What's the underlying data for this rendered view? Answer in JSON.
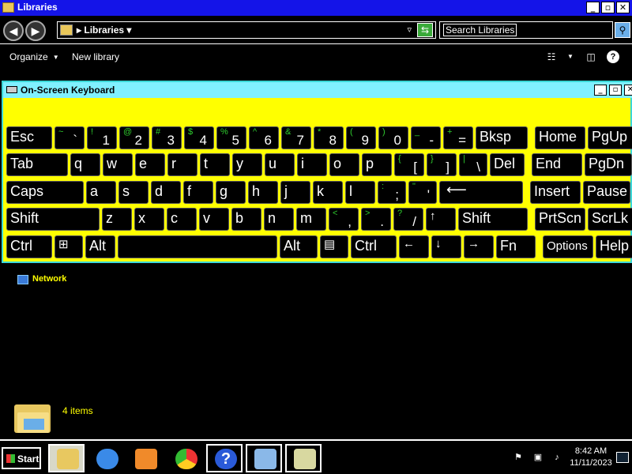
{
  "window": {
    "title": "Libraries",
    "minimize": "_",
    "maximize": "▫",
    "close": "✕"
  },
  "address": {
    "path_sep": "▸",
    "path": "Libraries",
    "path_drop": "▾",
    "dropdown": "▿",
    "search_placeholder": "Search Libraries"
  },
  "commands": {
    "organize": "Organize",
    "new_library": "New library"
  },
  "osk": {
    "title": "On-Screen Keyboard",
    "rows": [
      [
        {
          "id": "esc",
          "label": "Esc"
        },
        {
          "id": "backtick",
          "sec": "~",
          "pri": "`"
        },
        {
          "id": "1",
          "sec": "!",
          "pri": "1"
        },
        {
          "id": "2",
          "sec": "@",
          "pri": "2"
        },
        {
          "id": "3",
          "sec": "#",
          "pri": "3"
        },
        {
          "id": "4",
          "sec": "$",
          "pri": "4"
        },
        {
          "id": "5",
          "sec": "%",
          "pri": "5"
        },
        {
          "id": "6",
          "sec": "^",
          "pri": "6"
        },
        {
          "id": "7",
          "sec": "&",
          "pri": "7"
        },
        {
          "id": "8",
          "sec": "*",
          "pri": "8"
        },
        {
          "id": "9",
          "sec": "(",
          "pri": "9"
        },
        {
          "id": "0",
          "sec": ")",
          "pri": "0"
        },
        {
          "id": "minus",
          "sec": "_",
          "pri": "-"
        },
        {
          "id": "equals",
          "sec": "+",
          "pri": "="
        },
        {
          "id": "bksp",
          "label": "Bksp"
        },
        {
          "id": "home",
          "label": "Home"
        },
        {
          "id": "pgup",
          "label": "PgUp"
        }
      ],
      [
        {
          "id": "tab",
          "label": "Tab"
        },
        {
          "id": "q",
          "label": "q"
        },
        {
          "id": "w",
          "label": "w"
        },
        {
          "id": "e",
          "label": "e"
        },
        {
          "id": "r",
          "label": "r"
        },
        {
          "id": "t",
          "label": "t"
        },
        {
          "id": "y",
          "label": "y"
        },
        {
          "id": "u",
          "label": "u"
        },
        {
          "id": "i",
          "label": "i"
        },
        {
          "id": "o",
          "label": "o"
        },
        {
          "id": "p",
          "label": "p"
        },
        {
          "id": "lbracket",
          "sec": "{",
          "pri": "["
        },
        {
          "id": "rbracket",
          "sec": "}",
          "pri": "]"
        },
        {
          "id": "backslash",
          "sec": "|",
          "pri": "\\"
        },
        {
          "id": "del",
          "label": "Del"
        },
        {
          "id": "end",
          "label": "End"
        },
        {
          "id": "pgdn",
          "label": "PgDn"
        }
      ],
      [
        {
          "id": "caps",
          "label": "Caps"
        },
        {
          "id": "a",
          "label": "a"
        },
        {
          "id": "s",
          "label": "s"
        },
        {
          "id": "d",
          "label": "d"
        },
        {
          "id": "f",
          "label": "f"
        },
        {
          "id": "g",
          "label": "g"
        },
        {
          "id": "h",
          "label": "h"
        },
        {
          "id": "j",
          "label": "j"
        },
        {
          "id": "k",
          "label": "k"
        },
        {
          "id": "l",
          "label": "l"
        },
        {
          "id": "semicolon",
          "sec": ":",
          "pri": ";"
        },
        {
          "id": "quote",
          "sec": "\"",
          "pri": "'"
        },
        {
          "id": "enter",
          "label": "⟵"
        },
        {
          "id": "insert",
          "label": "Insert"
        },
        {
          "id": "pause",
          "label": "Pause"
        }
      ],
      [
        {
          "id": "lshift",
          "label": "Shift"
        },
        {
          "id": "z",
          "label": "z"
        },
        {
          "id": "x",
          "label": "x"
        },
        {
          "id": "c",
          "label": "c"
        },
        {
          "id": "v",
          "label": "v"
        },
        {
          "id": "b",
          "label": "b"
        },
        {
          "id": "n",
          "label": "n"
        },
        {
          "id": "m",
          "label": "m"
        },
        {
          "id": "comma",
          "sec": "<",
          "pri": ","
        },
        {
          "id": "period",
          "sec": ">",
          "pri": "."
        },
        {
          "id": "slash",
          "sec": "?",
          "pri": "/"
        },
        {
          "id": "up",
          "label": "↑"
        },
        {
          "id": "rshift",
          "label": "Shift"
        },
        {
          "id": "prtscn",
          "label": "PrtScn"
        },
        {
          "id": "scrlk",
          "label": "ScrLk"
        }
      ],
      [
        {
          "id": "lctrl",
          "label": "Ctrl"
        },
        {
          "id": "win",
          "label": "⊞"
        },
        {
          "id": "lalt",
          "label": "Alt"
        },
        {
          "id": "space",
          "label": ""
        },
        {
          "id": "ralt",
          "label": "Alt"
        },
        {
          "id": "menu",
          "label": "▤"
        },
        {
          "id": "rctrl",
          "label": "Ctrl"
        },
        {
          "id": "left",
          "label": "←"
        },
        {
          "id": "down",
          "label": "↓"
        },
        {
          "id": "right",
          "label": "→"
        },
        {
          "id": "fn",
          "label": "Fn"
        },
        {
          "id": "options",
          "label": "Options"
        },
        {
          "id": "help",
          "label": "Help"
        }
      ]
    ]
  },
  "content": {
    "network_label": "Network",
    "items_count": "4 items"
  },
  "taskbar": {
    "start_label": "Start",
    "time": "8:42 AM",
    "date": "11/11/2023",
    "help_glyph": "?"
  }
}
